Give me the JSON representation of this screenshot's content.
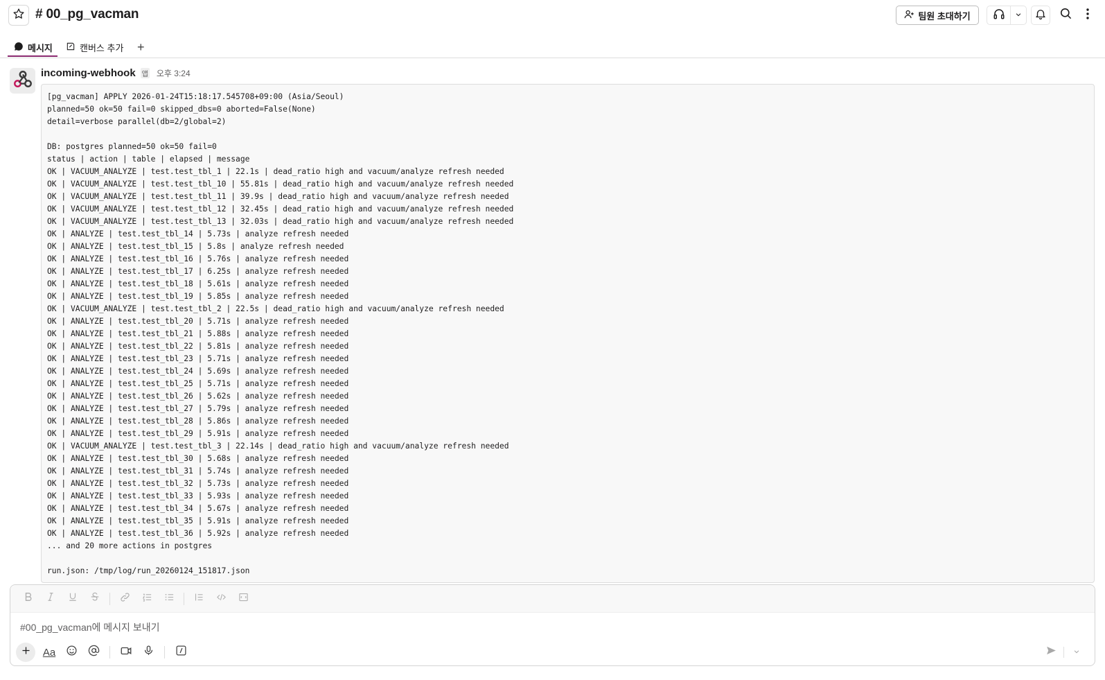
{
  "header": {
    "channel_name": "# 00_pg_vacman",
    "invite_label": "팀원 초대하기"
  },
  "tabs": [
    {
      "label": "메시지"
    },
    {
      "label": "캔버스 추가"
    },
    {
      "label": "+"
    }
  ],
  "message": {
    "sender": "incoming-webhook",
    "badge": "앱",
    "time": "오후 3:24",
    "lines": [
      "[pg_vacman] APPLY 2026-01-24T15:18:17.545708+09:00 (Asia/Seoul)",
      "planned=50 ok=50 fail=0 skipped_dbs=0 aborted=False(None)",
      "detail=verbose parallel(db=2/global=2)",
      "",
      "DB: postgres planned=50 ok=50 fail=0",
      "status | action | table | elapsed | message",
      "OK | VACUUM_ANALYZE | test.test_tbl_1 | 22.1s | dead_ratio high and vacuum/analyze refresh needed",
      "OK | VACUUM_ANALYZE | test.test_tbl_10 | 55.81s | dead_ratio high and vacuum/analyze refresh needed",
      "OK | VACUUM_ANALYZE | test.test_tbl_11 | 39.9s | dead_ratio high and vacuum/analyze refresh needed",
      "OK | VACUUM_ANALYZE | test.test_tbl_12 | 32.45s | dead_ratio high and vacuum/analyze refresh needed",
      "OK | VACUUM_ANALYZE | test.test_tbl_13 | 32.03s | dead_ratio high and vacuum/analyze refresh needed",
      "OK | ANALYZE | test.test_tbl_14 | 5.73s | analyze refresh needed",
      "OK | ANALYZE | test.test_tbl_15 | 5.8s | analyze refresh needed",
      "OK | ANALYZE | test.test_tbl_16 | 5.76s | analyze refresh needed",
      "OK | ANALYZE | test.test_tbl_17 | 6.25s | analyze refresh needed",
      "OK | ANALYZE | test.test_tbl_18 | 5.61s | analyze refresh needed",
      "OK | ANALYZE | test.test_tbl_19 | 5.85s | analyze refresh needed",
      "OK | VACUUM_ANALYZE | test.test_tbl_2 | 22.5s | dead_ratio high and vacuum/analyze refresh needed",
      "OK | ANALYZE | test.test_tbl_20 | 5.71s | analyze refresh needed",
      "OK | ANALYZE | test.test_tbl_21 | 5.88s | analyze refresh needed",
      "OK | ANALYZE | test.test_tbl_22 | 5.81s | analyze refresh needed",
      "OK | ANALYZE | test.test_tbl_23 | 5.71s | analyze refresh needed",
      "OK | ANALYZE | test.test_tbl_24 | 5.69s | analyze refresh needed",
      "OK | ANALYZE | test.test_tbl_25 | 5.71s | analyze refresh needed",
      "OK | ANALYZE | test.test_tbl_26 | 5.62s | analyze refresh needed",
      "OK | ANALYZE | test.test_tbl_27 | 5.79s | analyze refresh needed",
      "OK | ANALYZE | test.test_tbl_28 | 5.86s | analyze refresh needed",
      "OK | ANALYZE | test.test_tbl_29 | 5.91s | analyze refresh needed",
      "OK | VACUUM_ANALYZE | test.test_tbl_3 | 22.14s | dead_ratio high and vacuum/analyze refresh needed",
      "OK | ANALYZE | test.test_tbl_30 | 5.68s | analyze refresh needed",
      "OK | ANALYZE | test.test_tbl_31 | 5.74s | analyze refresh needed",
      "OK | ANALYZE | test.test_tbl_32 | 5.73s | analyze refresh needed",
      "OK | ANALYZE | test.test_tbl_33 | 5.93s | analyze refresh needed",
      "OK | ANALYZE | test.test_tbl_34 | 5.67s | analyze refresh needed",
      "OK | ANALYZE | test.test_tbl_35 | 5.91s | analyze refresh needed",
      "OK | ANALYZE | test.test_tbl_36 | 5.92s | analyze refresh needed",
      "... and 20 more actions in postgres",
      "",
      "run.json: /tmp/log/run_20260124_151817.json"
    ]
  },
  "composer": {
    "placeholder": "#00_pg_vacman에 메시지 보내기",
    "aa_label": "Aa"
  },
  "icons": {
    "star": "star-icon",
    "invite": "add-user-icon",
    "huddle": "headphones-icon",
    "chevron": "chevron-down-icon",
    "bell": "bell-icon",
    "search": "search-icon",
    "more": "more-vertical-icon",
    "messages_tab": "message-bubble-icon",
    "canvas_tab": "canvas-icon",
    "avatar": "webhook-icon"
  },
  "colors": {
    "accent": "#8a2a6f",
    "webhook_pink": "#c2185b"
  }
}
